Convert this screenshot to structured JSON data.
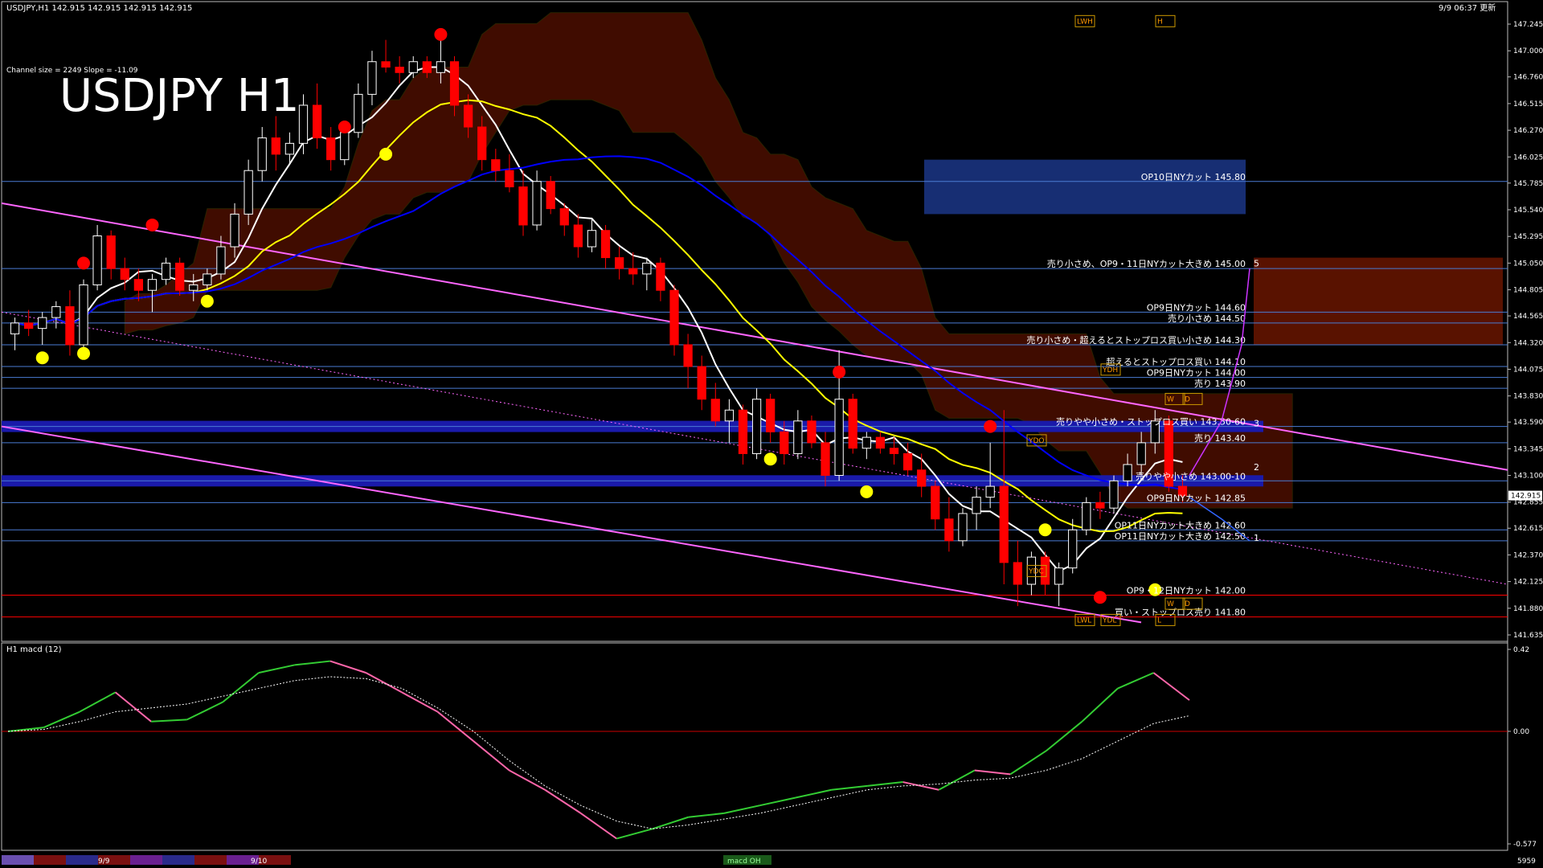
{
  "header": {
    "symbol_info": "USDJPY,H1  142.915 142.915 142.915 142.915",
    "timestamp": "9/9 06:37 更新",
    "channel_info": "Channel size = 2249 Slope = -11.09",
    "big_title": "USDJPY H1"
  },
  "colors": {
    "background": "#000000",
    "candle_up": "#ffffff",
    "candle_down": "#ff0000",
    "ma_fast": "#ffffff",
    "ma_mid": "#ffff00",
    "ma_slow": "#0000ff",
    "channel": "#ff66ff",
    "cloud_red": "#ff3300",
    "cloud_blue": "#3366ff",
    "level_line": "#4a7bd4",
    "support_line": "#ff0000",
    "macd_main_up": "#33cc33",
    "macd_main_down": "#ff66aa"
  },
  "price_axis": {
    "ticks": [
      "147.245",
      "147.000",
      "146.760",
      "146.515",
      "146.270",
      "146.025",
      "145.785",
      "145.540",
      "145.295",
      "145.050",
      "144.805",
      "144.565",
      "144.320",
      "144.075",
      "143.830",
      "143.590",
      "143.345",
      "143.100",
      "142.915",
      "142.855",
      "142.615",
      "142.370",
      "142.125",
      "141.880",
      "141.635"
    ],
    "current_price": "142.915"
  },
  "levels": [
    {
      "label": "OP10日NYカット 145.80",
      "price": 145.8,
      "color": "#4a7bd4"
    },
    {
      "label": "売り小さめ、OP9・11日NYカット大きめ 145.00",
      "price": 145.0,
      "color": "#4a7bd4"
    },
    {
      "label": "OP9日NYカット 144.60",
      "price": 144.6,
      "color": "#4a7bd4"
    },
    {
      "label": "売り小さめ 144.50",
      "price": 144.5,
      "color": "#4a7bd4"
    },
    {
      "label": "売り小さめ・超えるとストップロス買い小さめ 144.30",
      "price": 144.3,
      "color": "#4a7bd4"
    },
    {
      "label": "超えるとストップロス買い 144.10",
      "price": 144.1,
      "color": "#4a7bd4"
    },
    {
      "label": "OP9日NYカット 144.00",
      "price": 144.0,
      "color": "#4a7bd4"
    },
    {
      "label": "売り 143.90",
      "price": 143.9,
      "color": "#4a7bd4"
    },
    {
      "label": "売りやや小さめ・ストップロス買い 143.50-60",
      "price": 143.55,
      "color": "#4a7bd4"
    },
    {
      "label": "売り 143.40",
      "price": 143.4,
      "color": "#4a7bd4"
    },
    {
      "label": "売りやや小さめ 143.00-10",
      "price": 143.05,
      "color": "#4a7bd4"
    },
    {
      "label": "OP9日NYカット 142.85",
      "price": 142.85,
      "color": "#4a7bd4"
    },
    {
      "label": "OP11日NYカット大きめ 142.60",
      "price": 142.6,
      "color": "#4a7bd4"
    },
    {
      "label": "OP11日NYカット大きめ 142.50",
      "price": 142.5,
      "color": "#4a7bd4"
    },
    {
      "label": "OP9・12日NYカット 142.00",
      "price": 142.0,
      "color": "#ff0000"
    },
    {
      "label": "買い・ストップロス売り 141.80",
      "price": 141.8,
      "color": "#ff0000"
    }
  ],
  "path_markers": [
    "5",
    "3",
    "2",
    "1"
  ],
  "box_labels": [
    "LWH",
    "H",
    "YDH",
    "W",
    "D",
    "YDO",
    "YDC",
    "LWL",
    "YDL",
    "L",
    "W",
    "D"
  ],
  "macd": {
    "title": "H1  macd (12)",
    "ticks": [
      "0.42",
      "0.00",
      "-0.577"
    ],
    "zero": "0.00"
  },
  "bottom_bar": {
    "dates": [
      "9/9",
      "9/10"
    ],
    "tab": "macd OH",
    "corner": "5959"
  },
  "chart_data": {
    "type": "candlestick",
    "title": "USDJPY H1",
    "ylim": [
      141.635,
      147.245
    ],
    "x_labels": [
      "9/9",
      "9/10"
    ],
    "candles_approx": [
      [
        144.4,
        144.55,
        144.25,
        144.5
      ],
      [
        144.5,
        144.62,
        144.38,
        144.45
      ],
      [
        144.45,
        144.6,
        144.3,
        144.55
      ],
      [
        144.55,
        144.7,
        144.45,
        144.65
      ],
      [
        144.65,
        144.8,
        144.2,
        144.3
      ],
      [
        144.3,
        144.9,
        144.25,
        144.85
      ],
      [
        144.85,
        145.4,
        144.8,
        145.3
      ],
      [
        145.3,
        145.35,
        144.9,
        145.0
      ],
      [
        145.0,
        145.1,
        144.8,
        144.9
      ],
      [
        144.9,
        145.0,
        144.7,
        144.8
      ],
      [
        144.8,
        144.95,
        144.6,
        144.9
      ],
      [
        144.9,
        145.1,
        144.85,
        145.05
      ],
      [
        145.05,
        145.1,
        144.75,
        144.8
      ],
      [
        144.8,
        144.95,
        144.7,
        144.85
      ],
      [
        144.85,
        145.0,
        144.8,
        144.95
      ],
      [
        144.95,
        145.3,
        144.9,
        145.2
      ],
      [
        145.2,
        145.6,
        145.1,
        145.5
      ],
      [
        145.5,
        146.0,
        145.4,
        145.9
      ],
      [
        145.9,
        146.3,
        145.8,
        146.2
      ],
      [
        146.2,
        146.4,
        145.9,
        146.05
      ],
      [
        146.05,
        146.25,
        145.95,
        146.15
      ],
      [
        146.15,
        146.6,
        146.05,
        146.5
      ],
      [
        146.5,
        146.7,
        146.1,
        146.2
      ],
      [
        146.2,
        146.3,
        145.9,
        146.0
      ],
      [
        146.0,
        146.3,
        145.95,
        146.25
      ],
      [
        146.25,
        146.7,
        146.2,
        146.6
      ],
      [
        146.6,
        147.0,
        146.5,
        146.9
      ],
      [
        146.9,
        147.1,
        146.8,
        146.85
      ],
      [
        146.85,
        146.95,
        146.7,
        146.8
      ],
      [
        146.8,
        146.95,
        146.75,
        146.9
      ],
      [
        146.9,
        146.95,
        146.75,
        146.8
      ],
      [
        146.8,
        147.2,
        146.7,
        146.9
      ],
      [
        146.9,
        146.95,
        146.4,
        146.5
      ],
      [
        146.5,
        146.6,
        146.2,
        146.3
      ],
      [
        146.3,
        146.4,
        145.9,
        146.0
      ],
      [
        146.0,
        146.1,
        145.8,
        145.9
      ],
      [
        145.9,
        146.05,
        145.7,
        145.75
      ],
      [
        145.75,
        145.9,
        145.3,
        145.4
      ],
      [
        145.4,
        145.9,
        145.35,
        145.8
      ],
      [
        145.8,
        145.85,
        145.5,
        145.55
      ],
      [
        145.55,
        145.6,
        145.3,
        145.4
      ],
      [
        145.4,
        145.5,
        145.1,
        145.2
      ],
      [
        145.2,
        145.45,
        145.15,
        145.35
      ],
      [
        145.35,
        145.4,
        145.0,
        145.1
      ],
      [
        145.1,
        145.2,
        144.9,
        145.0
      ],
      [
        145.0,
        145.15,
        144.85,
        144.95
      ],
      [
        144.95,
        145.1,
        144.8,
        145.05
      ],
      [
        145.05,
        145.1,
        144.7,
        144.8
      ],
      [
        144.8,
        144.85,
        144.2,
        144.3
      ],
      [
        144.3,
        144.4,
        143.9,
        144.1
      ],
      [
        144.1,
        144.2,
        143.7,
        143.8
      ],
      [
        143.8,
        143.95,
        143.55,
        143.6
      ],
      [
        143.6,
        143.8,
        143.4,
        143.7
      ],
      [
        143.7,
        143.75,
        143.2,
        143.3
      ],
      [
        143.3,
        143.9,
        143.25,
        143.8
      ],
      [
        143.8,
        143.85,
        143.4,
        143.5
      ],
      [
        143.5,
        143.6,
        143.2,
        143.3
      ],
      [
        143.3,
        143.7,
        143.25,
        143.6
      ],
      [
        143.6,
        143.65,
        143.35,
        143.4
      ],
      [
        143.4,
        143.5,
        143.0,
        143.1
      ],
      [
        143.1,
        144.25,
        143.05,
        143.8
      ],
      [
        143.8,
        143.85,
        143.3,
        143.35
      ],
      [
        143.35,
        143.5,
        143.25,
        143.45
      ],
      [
        143.45,
        143.5,
        143.3,
        143.35
      ],
      [
        143.35,
        143.45,
        143.2,
        143.3
      ],
      [
        143.3,
        143.4,
        143.1,
        143.15
      ],
      [
        143.15,
        143.3,
        142.9,
        143.0
      ],
      [
        143.0,
        143.05,
        142.6,
        142.7
      ],
      [
        142.7,
        142.9,
        142.4,
        142.5
      ],
      [
        142.5,
        142.8,
        142.45,
        142.75
      ],
      [
        142.75,
        143.0,
        142.6,
        142.9
      ],
      [
        142.9,
        143.4,
        142.8,
        143.0
      ],
      [
        143.0,
        143.7,
        142.1,
        142.3
      ],
      [
        142.3,
        142.5,
        141.9,
        142.1
      ],
      [
        142.1,
        142.4,
        142.0,
        142.35
      ],
      [
        142.35,
        142.4,
        142.0,
        142.1
      ],
      [
        142.1,
        142.3,
        141.9,
        142.25
      ],
      [
        142.25,
        142.7,
        142.2,
        142.6
      ],
      [
        142.6,
        142.9,
        142.55,
        142.85
      ],
      [
        142.85,
        142.95,
        142.7,
        142.8
      ],
      [
        142.8,
        143.1,
        142.75,
        143.05
      ],
      [
        143.05,
        143.3,
        143.0,
        143.2
      ],
      [
        143.2,
        143.5,
        143.1,
        143.4
      ],
      [
        143.4,
        143.7,
        143.3,
        143.6
      ],
      [
        143.6,
        143.65,
        142.95,
        143.0
      ],
      [
        143.0,
        143.1,
        142.85,
        142.915
      ]
    ],
    "macd_main_approx": [
      0.0,
      0.02,
      0.1,
      0.2,
      0.05,
      0.06,
      0.15,
      0.3,
      0.34,
      0.36,
      0.3,
      0.2,
      0.1,
      -0.05,
      -0.2,
      -0.3,
      -0.42,
      -0.55,
      -0.5,
      -0.44,
      -0.42,
      -0.38,
      -0.34,
      -0.3,
      -0.28,
      -0.26,
      -0.3,
      -0.2,
      -0.22,
      -0.1,
      0.05,
      0.22,
      0.3,
      0.16
    ],
    "macd_signal_approx": [
      0.0,
      0.01,
      0.05,
      0.1,
      0.12,
      0.14,
      0.18,
      0.22,
      0.26,
      0.28,
      0.27,
      0.22,
      0.12,
      0.0,
      -0.15,
      -0.28,
      -0.38,
      -0.46,
      -0.5,
      -0.48,
      -0.45,
      -0.42,
      -0.38,
      -0.34,
      -0.3,
      -0.28,
      -0.27,
      -0.25,
      -0.24,
      -0.2,
      -0.14,
      -0.05,
      0.04,
      0.08
    ]
  }
}
